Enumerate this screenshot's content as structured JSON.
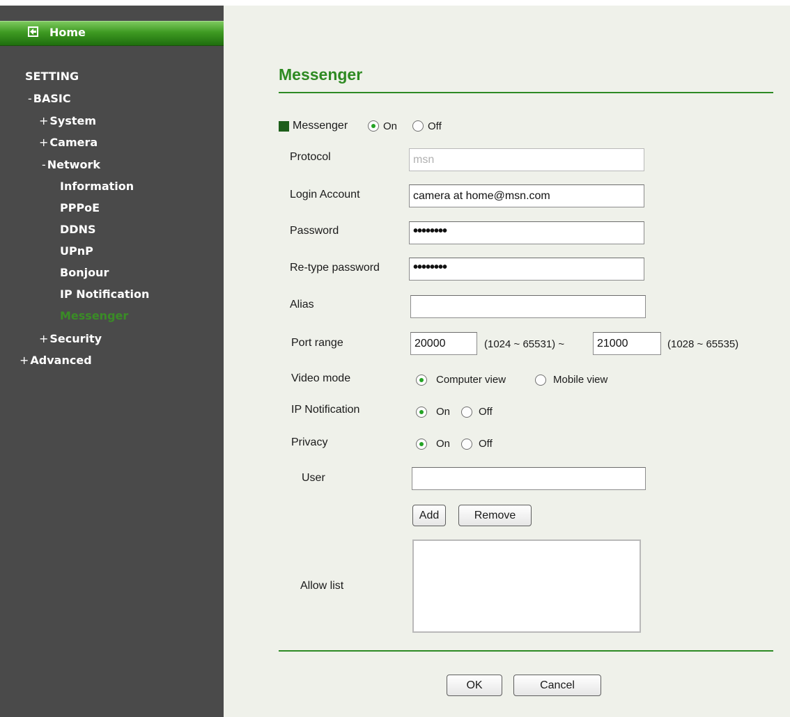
{
  "sidebar": {
    "home_label": "Home",
    "items": [
      {
        "prefix": "",
        "label": "SETTING"
      },
      {
        "prefix": "-",
        "label": "BASIC"
      },
      {
        "prefix": "+",
        "label": "System"
      },
      {
        "prefix": "+",
        "label": "Camera"
      },
      {
        "prefix": "-",
        "label": "Network"
      },
      {
        "prefix": "",
        "label": "Information"
      },
      {
        "prefix": "",
        "label": "PPPoE"
      },
      {
        "prefix": "",
        "label": "DDNS"
      },
      {
        "prefix": "",
        "label": "UPnP"
      },
      {
        "prefix": "",
        "label": "Bonjour"
      },
      {
        "prefix": "",
        "label": "IP Notification"
      },
      {
        "prefix": "",
        "label": "Messenger"
      },
      {
        "prefix": "+",
        "label": "Security"
      },
      {
        "prefix": "+",
        "label": "Advanced"
      }
    ],
    "active_item": "Messenger",
    "colors": {
      "background": "#4a4a4a",
      "active": "#3a8c26",
      "home_bar": "#3e9a22"
    }
  },
  "main": {
    "title": "Messenger",
    "messenger": {
      "label": "Messenger",
      "on_label": "On",
      "off_label": "Off",
      "value": "On"
    },
    "protocol": {
      "label": "Protocol",
      "value": "msn"
    },
    "login_account": {
      "label": "Login Account",
      "value": "camera at home@msn.com"
    },
    "password": {
      "label": "Password",
      "value": "••••••••"
    },
    "retype_password": {
      "label": "Re-type password",
      "value": "••••••••"
    },
    "alias": {
      "label": "Alias",
      "value": ""
    },
    "port_range": {
      "label": "Port range",
      "start": "20000",
      "start_hint": "(1024 ~ 65531) ~",
      "end": "21000",
      "end_hint": "(1028 ~ 65535)"
    },
    "video_mode": {
      "label": "Video mode",
      "option1": "Computer view",
      "option2": "Mobile view",
      "value": "Computer view"
    },
    "ip_notification": {
      "label": "IP Notification",
      "on_label": "On",
      "off_label": "Off",
      "value": "On"
    },
    "privacy": {
      "label": "Privacy",
      "on_label": "On",
      "off_label": "Off",
      "value": "On"
    },
    "user": {
      "label": "User",
      "value": ""
    },
    "add_button": "Add",
    "remove_button": "Remove",
    "allow_list": {
      "label": "Allow list",
      "items": []
    },
    "ok_button": "OK",
    "cancel_button": "Cancel"
  },
  "colors": {
    "accent": "#2e8a22",
    "main_background": "#eff1ea"
  }
}
